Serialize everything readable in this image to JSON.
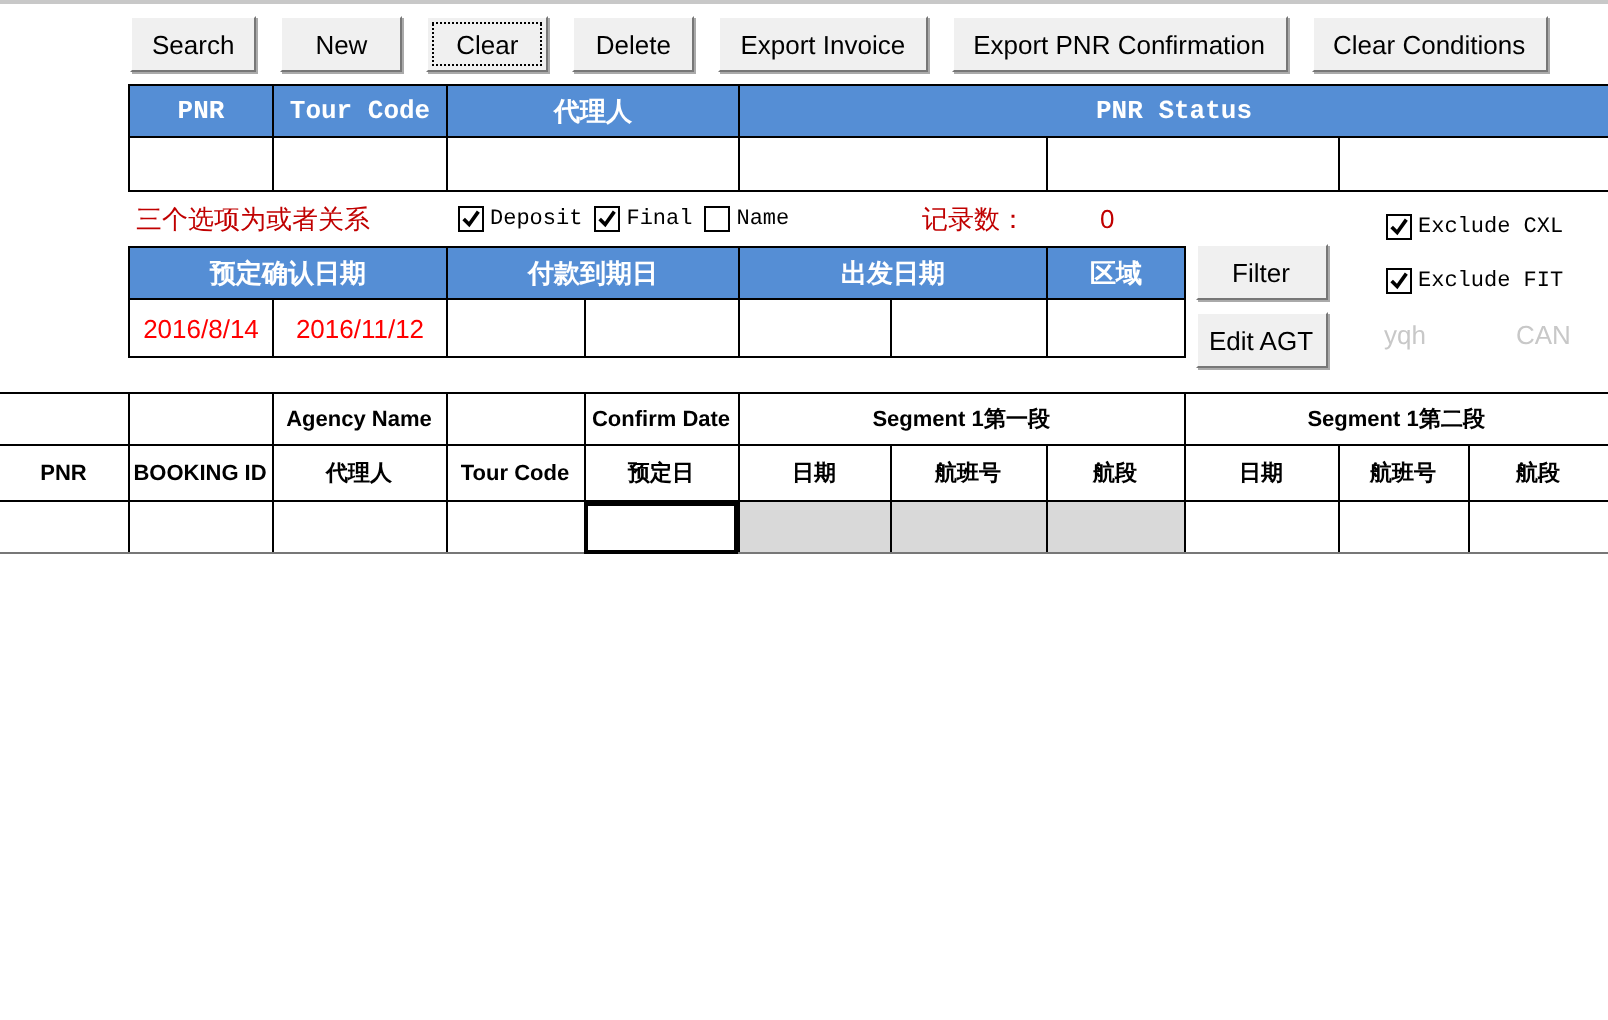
{
  "toolbar": [
    {
      "label": "Search",
      "focused": false
    },
    {
      "label": "New",
      "focused": false
    },
    {
      "label": "Clear",
      "focused": true
    },
    {
      "label": "Delete",
      "focused": false
    },
    {
      "label": "Export Invoice",
      "focused": false
    },
    {
      "label": "Export PNR Confirmation",
      "focused": false
    },
    {
      "label": "Clear Conditions",
      "focused": false
    }
  ],
  "search_grid": {
    "headers": [
      "PNR",
      "Tour Code",
      "代理人"
    ],
    "status_header": "PNR Status"
  },
  "options": {
    "note": "三个选项为或者关系",
    "checkboxes": [
      {
        "label": "Deposit",
        "checked": true
      },
      {
        "label": "Final",
        "checked": true
      },
      {
        "label": "Name",
        "checked": false
      }
    ],
    "record_label": "记录数：",
    "record_count": "0"
  },
  "date_grid": {
    "headers": [
      "预定确认日期",
      "付款到期日",
      "出发日期",
      "区域"
    ],
    "values": [
      "2016/8/14",
      "2016/11/12"
    ]
  },
  "side_buttons": [
    "Filter",
    "Edit AGT"
  ],
  "excludes": [
    {
      "label": "Exclude CXL",
      "checked": true
    },
    {
      "label": "Exclude FIT",
      "checked": true
    }
  ],
  "faint_labels": [
    "yqh",
    "CAN"
  ],
  "results": {
    "leading_columns": [
      {
        "label": "PNR"
      },
      {
        "label": "BOOKING ID"
      },
      {
        "top": "Agency Name",
        "label": "代理人"
      },
      {
        "label": "Tour Code"
      },
      {
        "top": "Confirm Date",
        "label": "预定日"
      }
    ],
    "segments": [
      {
        "label": "Segment 1第一段",
        "columns": [
          "日期",
          "航班号",
          "航段"
        ]
      },
      {
        "label": "Segment 1第二段",
        "columns": [
          "日期",
          "航班号",
          "航段"
        ]
      }
    ],
    "row": [
      {
        "selected": false,
        "shaded": false
      },
      {
        "selected": false,
        "shaded": false
      },
      {
        "selected": false,
        "shaded": false
      },
      {
        "selected": false,
        "shaded": false
      },
      {
        "selected": true,
        "shaded": false
      },
      {
        "selected": false,
        "shaded": true
      },
      {
        "selected": false,
        "shaded": true
      },
      {
        "selected": false,
        "shaded": true
      },
      {
        "selected": false,
        "shaded": false
      },
      {
        "selected": false,
        "shaded": false
      },
      {
        "selected": false,
        "shaded": false
      }
    ]
  }
}
